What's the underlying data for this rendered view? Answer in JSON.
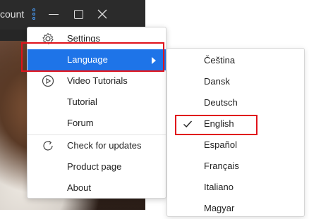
{
  "window": {
    "title_fragment": "count"
  },
  "menu": {
    "items": [
      {
        "label": "Settings",
        "icon": "gear-icon"
      },
      {
        "label": "Language",
        "icon": "",
        "submenu": true
      },
      {
        "label": "Video Tutorials",
        "icon": "play-circle-icon"
      },
      {
        "label": "Tutorial",
        "icon": ""
      },
      {
        "label": "Forum",
        "icon": ""
      },
      {
        "label": "Check for updates",
        "icon": "refresh-icon"
      },
      {
        "label": "Product page",
        "icon": ""
      },
      {
        "label": "About",
        "icon": ""
      }
    ]
  },
  "submenu": {
    "items": [
      {
        "label": "Čeština",
        "checked": false
      },
      {
        "label": "Dansk",
        "checked": false
      },
      {
        "label": "Deutsch",
        "checked": false
      },
      {
        "label": "English",
        "checked": true
      },
      {
        "label": "Español",
        "checked": false
      },
      {
        "label": "Français",
        "checked": false
      },
      {
        "label": "Italiano",
        "checked": false
      },
      {
        "label": "Magyar",
        "checked": false
      }
    ]
  },
  "colors": {
    "accent": "#1e74e8",
    "annotation": "#e0121b"
  }
}
